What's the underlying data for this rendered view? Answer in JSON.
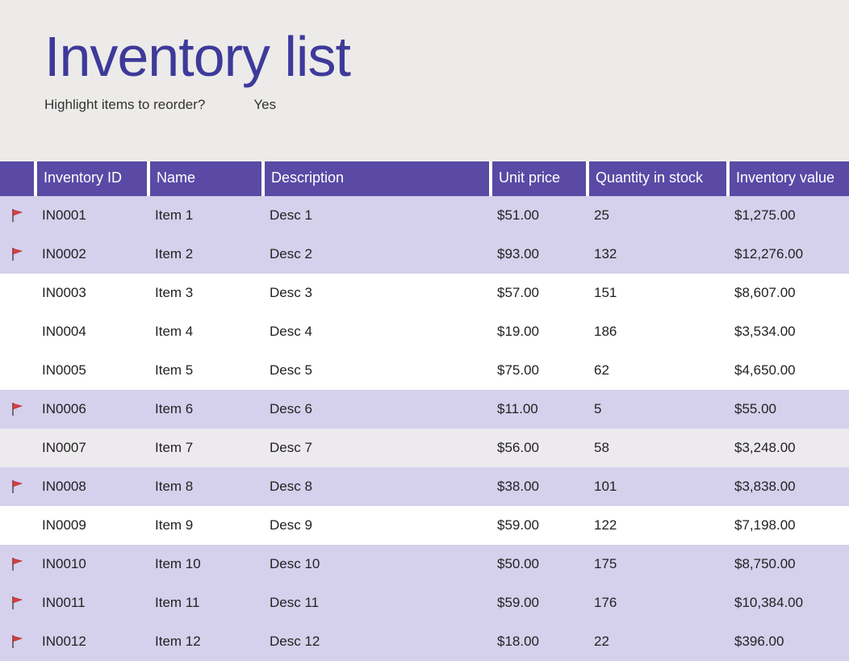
{
  "header": {
    "title": "Inventory list",
    "subhead_label": "Highlight items to reorder?",
    "subhead_value": "Yes"
  },
  "columns": {
    "flag": "",
    "id": "Inventory ID",
    "name": "Name",
    "description": "Description",
    "unit_price": "Unit price",
    "qty": "Quantity in stock",
    "value": "Inventory value"
  },
  "rows": [
    {
      "flag": true,
      "shade": "high",
      "id": "IN0001",
      "name": "Item 1",
      "description": "Desc 1",
      "unit_price": "$51.00",
      "qty": "25",
      "value": "$1,275.00"
    },
    {
      "flag": true,
      "shade": "high",
      "id": "IN0002",
      "name": "Item 2",
      "description": "Desc 2",
      "unit_price": "$93.00",
      "qty": "132",
      "value": "$12,276.00"
    },
    {
      "flag": false,
      "shade": "none",
      "id": "IN0003",
      "name": "Item 3",
      "description": "Desc 3",
      "unit_price": "$57.00",
      "qty": "151",
      "value": "$8,607.00"
    },
    {
      "flag": false,
      "shade": "none",
      "id": "IN0004",
      "name": "Item 4",
      "description": "Desc 4",
      "unit_price": "$19.00",
      "qty": "186",
      "value": "$3,534.00"
    },
    {
      "flag": false,
      "shade": "none",
      "id": "IN0005",
      "name": "Item 5",
      "description": "Desc 5",
      "unit_price": "$75.00",
      "qty": "62",
      "value": "$4,650.00"
    },
    {
      "flag": true,
      "shade": "high",
      "id": "IN0006",
      "name": "Item 6",
      "description": "Desc 6",
      "unit_price": "$11.00",
      "qty": "5",
      "value": "$55.00"
    },
    {
      "flag": false,
      "shade": "soft",
      "id": "IN0007",
      "name": "Item 7",
      "description": "Desc 7",
      "unit_price": "$56.00",
      "qty": "58",
      "value": "$3,248.00"
    },
    {
      "flag": true,
      "shade": "high",
      "id": "IN0008",
      "name": "Item 8",
      "description": "Desc 8",
      "unit_price": "$38.00",
      "qty": "101",
      "value": "$3,838.00"
    },
    {
      "flag": false,
      "shade": "none",
      "id": "IN0009",
      "name": "Item 9",
      "description": "Desc 9",
      "unit_price": "$59.00",
      "qty": "122",
      "value": "$7,198.00"
    },
    {
      "flag": true,
      "shade": "high",
      "id": "IN0010",
      "name": "Item 10",
      "description": "Desc 10",
      "unit_price": "$50.00",
      "qty": "175",
      "value": "$8,750.00"
    },
    {
      "flag": true,
      "shade": "high",
      "id": "IN0011",
      "name": "Item 11",
      "description": "Desc 11",
      "unit_price": "$59.00",
      "qty": "176",
      "value": "$10,384.00"
    },
    {
      "flag": true,
      "shade": "high",
      "id": "IN0012",
      "name": "Item 12",
      "description": "Desc 12",
      "unit_price": "$18.00",
      "qty": "22",
      "value": "$396.00"
    }
  ]
}
